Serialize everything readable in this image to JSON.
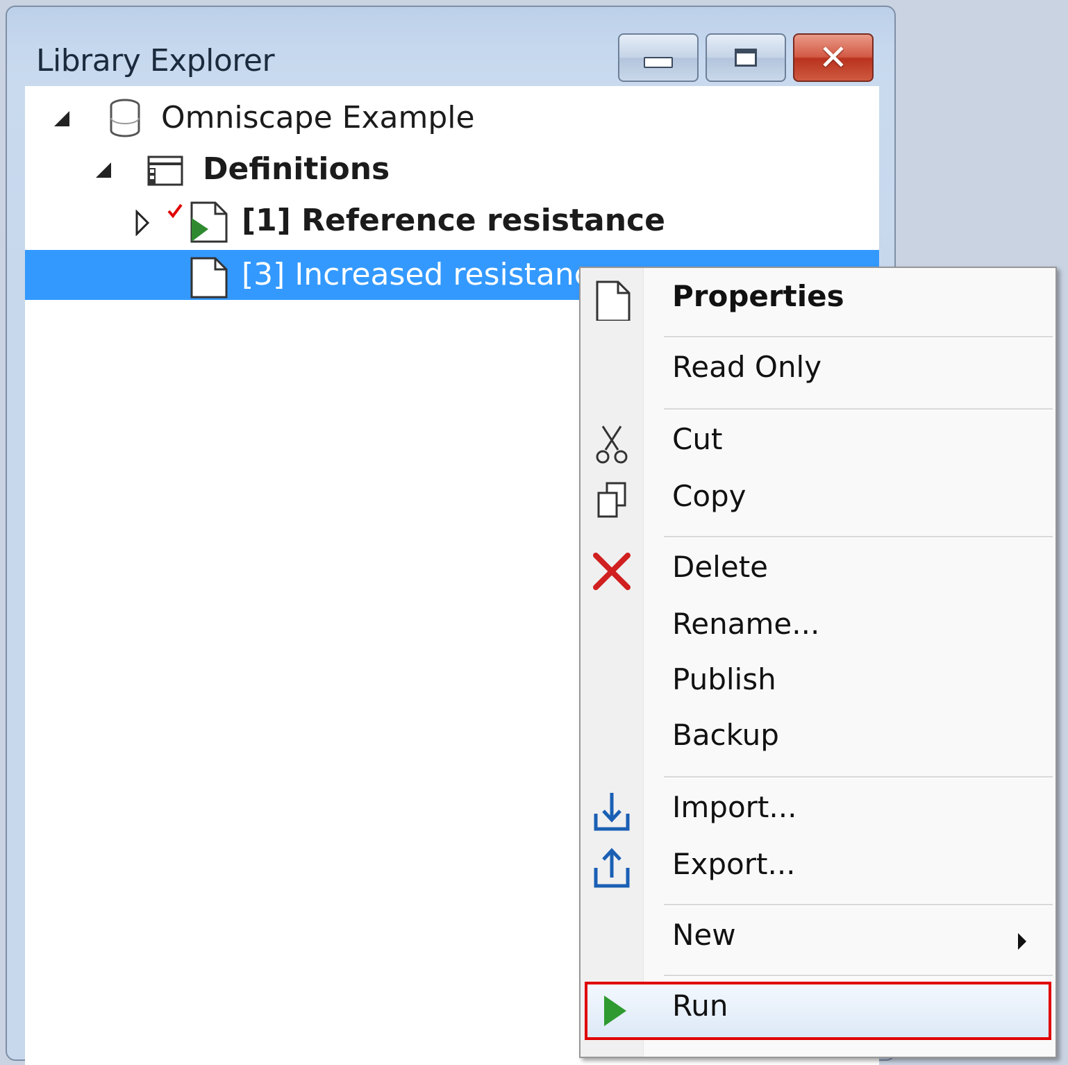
{
  "window": {
    "title": "Library Explorer",
    "buttons": [
      "minimize",
      "maximize",
      "close"
    ]
  },
  "tree": {
    "items": [
      {
        "label": "Omniscape Example",
        "icon": "database-icon",
        "expanded": true
      },
      {
        "label": "Definitions",
        "icon": "definitions-icon",
        "expanded": true,
        "bold": true
      },
      {
        "label": "[1] Reference resistance",
        "icon": "scenario-results-icon",
        "expanded": false,
        "bold": true,
        "checked": true
      },
      {
        "label": "[3] Increased resistance",
        "icon": "document-icon",
        "selected": true
      }
    ]
  },
  "context_menu": {
    "items": [
      {
        "label": "Properties",
        "icon": "document-icon",
        "bold": true
      },
      {
        "label": "Read Only"
      },
      {
        "label": "Cut",
        "icon": "scissors-icon"
      },
      {
        "label": "Copy",
        "icon": "copy-icon"
      },
      {
        "label": "Delete",
        "icon": "delete-x-icon"
      },
      {
        "label": "Rename..."
      },
      {
        "label": "Publish"
      },
      {
        "label": "Backup"
      },
      {
        "label": "Import...",
        "icon": "import-icon"
      },
      {
        "label": "Export...",
        "icon": "export-icon"
      },
      {
        "label": "New",
        "submenu": true
      },
      {
        "label": "Run",
        "icon": "run-play-icon",
        "highlighted": true
      }
    ]
  },
  "colors": {
    "selection": "#3399ff",
    "highlight_border": "#e00000",
    "run_green": "#2f9a2f",
    "delete_red": "#d02020",
    "import_blue": "#1a5fb4"
  }
}
